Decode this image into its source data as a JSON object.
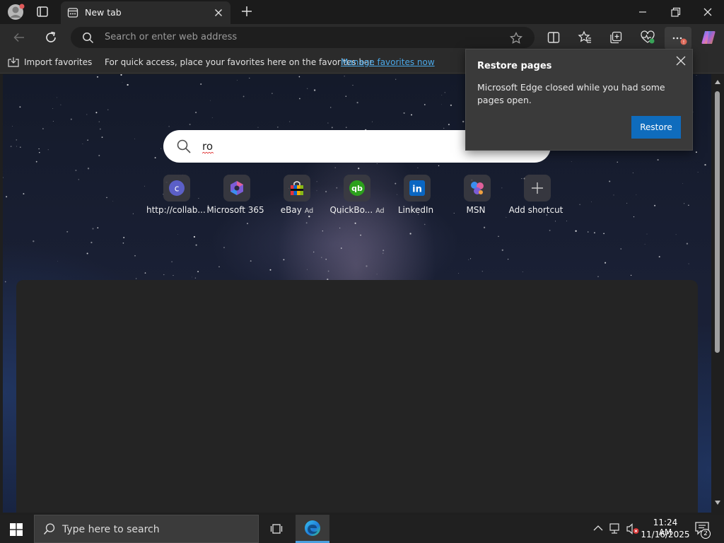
{
  "browser": {
    "tab": {
      "title": "New tab",
      "favicon": "newtab-icon"
    },
    "address": {
      "placeholder": "Search or enter web address"
    },
    "toolbar_icons": [
      "back-icon",
      "refresh-icon",
      "star-icon",
      "split-screen-icon",
      "favorites-icon",
      "collections-icon",
      "performance-icon",
      "more-icon",
      "copilot-icon"
    ],
    "favorites_bar": {
      "import_label": "Import favorites",
      "message": "For quick access, place your favorites here on the favorites bar.",
      "link": "Manage favorites now"
    }
  },
  "new_tab": {
    "search_value": "ro",
    "tiles": [
      {
        "label": "http://collab...",
        "ad": "",
        "icon": "collab-c-icon"
      },
      {
        "label": "Microsoft 365",
        "ad": "",
        "icon": "microsoft365-icon"
      },
      {
        "label": "eBay",
        "ad": "Ad",
        "icon": "ebay-bag-icon"
      },
      {
        "label": "QuickBo...",
        "ad": "Ad",
        "icon": "quickbooks-icon"
      },
      {
        "label": "LinkedIn",
        "ad": "",
        "icon": "linkedin-icon"
      },
      {
        "label": "MSN",
        "ad": "",
        "icon": "msn-icon"
      },
      {
        "label": "Add shortcut",
        "ad": "",
        "icon": "plus-icon"
      }
    ]
  },
  "restore_popup": {
    "title": "Restore pages",
    "body": "Microsoft Edge closed while you had some pages open.",
    "button": "Restore"
  },
  "taskbar": {
    "search_placeholder": "Type here to search",
    "time": "11:24 AM",
    "date": "11/16/2025",
    "notification_count": "2"
  },
  "colors": {
    "accent": "#0f6cbd",
    "link": "#4aa8e8",
    "taskbar": "#202020"
  }
}
